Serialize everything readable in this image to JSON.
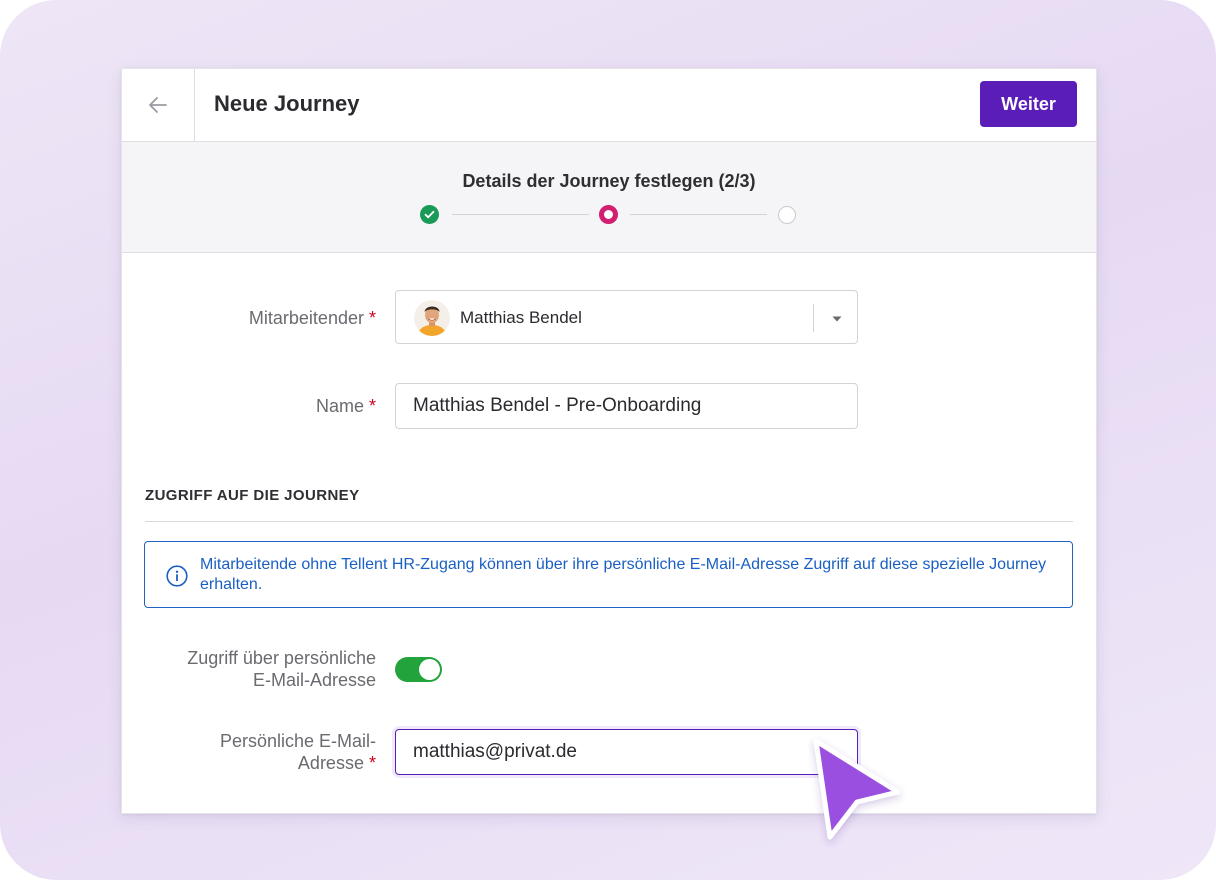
{
  "header": {
    "back_icon": "arrow-left-icon",
    "title": "Neue Journey",
    "next_label": "Weiter"
  },
  "stepper": {
    "title": "Details der Journey festlegen (2/3)",
    "steps": [
      {
        "status": "completed",
        "color": "#1a9a57"
      },
      {
        "status": "current",
        "color": "#d21f6f"
      },
      {
        "status": "upcoming",
        "color": "#c9c9cf"
      }
    ]
  },
  "form": {
    "employee": {
      "label": "Mitarbeitender",
      "required_mark": "*",
      "value": "Matthias Bendel"
    },
    "name": {
      "label": "Name",
      "required_mark": "*",
      "value": "Matthias Bendel - Pre-Onboarding"
    },
    "access_section": {
      "title": "ZUGRIFF AUF DIE JOURNEY",
      "info": "Mitarbeitende ohne Tellent HR-Zugang können über ihre persönliche E-Mail-Adresse Zugriff auf diese spezielle Journey erhalten."
    },
    "personal_access": {
      "label_line1": "Zugriff über persönliche",
      "label_line2": "E-Mail-Adresse",
      "enabled": true
    },
    "personal_email": {
      "label_line1": "Persönliche E-Mail-",
      "label_line2": "Adresse",
      "required_mark": "*",
      "value": "matthias@privat.de"
    }
  },
  "colors": {
    "primary": "#5a1db8",
    "toggle_on": "#22a33b",
    "info": "#1f63c6",
    "required": "#d0021b",
    "cursor": "#9b4fe0"
  }
}
